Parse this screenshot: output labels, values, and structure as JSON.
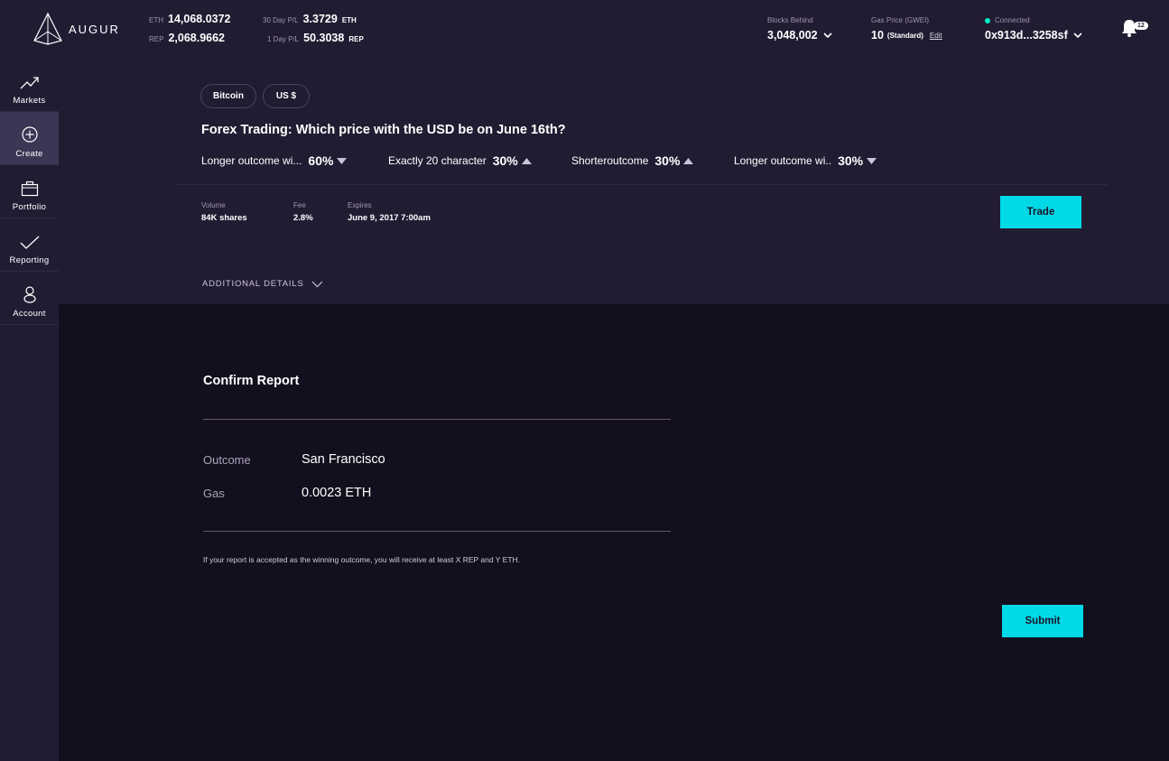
{
  "header": {
    "logo_text": "AUGUR",
    "eth_label": "ETH",
    "eth_value": "14,068.0372",
    "rep_label": "REP",
    "rep_value": "2,068.9662",
    "pl30_label": "30 Day P/L",
    "pl30_value": "3.3729",
    "pl30_unit": "ETH",
    "pl1_label": "1 Day P/L",
    "pl1_value": "50.3038",
    "pl1_unit": "REP",
    "blocks_label": "Blocks Behind",
    "blocks_value": "3,048,002",
    "gas_label": "Gas Price (GWEI)",
    "gas_value": "10",
    "gas_sub": "(Standard)",
    "gas_edit": "Edit",
    "conn_label": "Connected",
    "conn_color": "#00f1c4",
    "account": "0x913d...3258sf",
    "notif_count": "12"
  },
  "sidebar": {
    "items": [
      {
        "label": "Markets",
        "icon": "trend-up-icon"
      },
      {
        "label": "Create",
        "icon": "plus-circle-icon"
      },
      {
        "label": "Portfolio",
        "icon": "briefcase-icon"
      },
      {
        "label": "Reporting",
        "icon": "check-icon"
      },
      {
        "label": "Account",
        "icon": "user-icon"
      }
    ],
    "active": "Create"
  },
  "market": {
    "tags": [
      "Bitcoin",
      "US $"
    ],
    "title": "Forex Trading: Which price with the USD be on June 16th?",
    "outcomes": [
      {
        "name": "Longer outcome wi...",
        "pct": "60%",
        "dir": "down"
      },
      {
        "name": "Exactly 20 character",
        "pct": "30%",
        "dir": "up"
      },
      {
        "name": "Shorteroutcome",
        "pct": "30%",
        "dir": "up"
      },
      {
        "name": "Longer outcome wi..",
        "pct": "30%",
        "dir": "down"
      }
    ],
    "volume_label": "Volume",
    "volume_value": "84K shares",
    "fee_label": "Fee",
    "fee_value": "2.8%",
    "expires_label": "Expires",
    "expires_value": "June 9, 2017 7:00am",
    "trade_label": "Trade",
    "additional_label": "ADDITIONAL DETAILS"
  },
  "confirm": {
    "title": "Confirm Report",
    "outcome_label": "Outcome",
    "outcome_value": "San Francisco",
    "gas_label": "Gas",
    "gas_value": "0.0023 ETH",
    "note": "If your report is accepted as the winning outcome, you will receive at least X REP and Y ETH.",
    "submit_label": "Submit"
  },
  "colors": {
    "accent": "#00d9e6",
    "panel": "#221c33",
    "background": "#130f1e"
  }
}
